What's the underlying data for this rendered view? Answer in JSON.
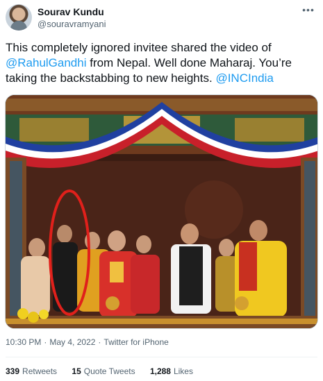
{
  "author": {
    "name": "Sourav Kundu",
    "handle": "@souravramyani"
  },
  "tweet": {
    "text_1": "This completely ignored invitee shared the video of ",
    "mention_1": "@RahulGandhi",
    "text_2": " from Nepal. Well done Maharaj. You’re taking the backstabbing to new heights. ",
    "mention_2": "@INCIndia"
  },
  "meta": {
    "time": "10:30 PM",
    "date": "May 4, 2022",
    "source": "Twitter for iPhone",
    "separator": "·"
  },
  "stats": {
    "retweets_count": "339",
    "retweets_label": "Retweets",
    "quotes_count": "15",
    "quotes_label": "Quote Tweets",
    "likes_count": "1,288",
    "likes_label": "Likes"
  },
  "icons": {
    "more": "more-options-icon"
  },
  "colors": {
    "link": "#1d9bf0",
    "secondary_text": "#536471",
    "primary_text": "#0f1419",
    "annotation_circle": "#e0201b"
  }
}
